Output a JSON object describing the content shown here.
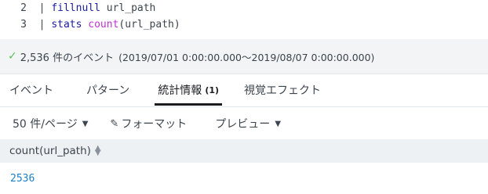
{
  "editor": {
    "lines": [
      {
        "number": "2",
        "pipe": "|",
        "command": "fillnull",
        "rest": " url_path"
      },
      {
        "number": "3",
        "pipe": "|",
        "command": "stats",
        "function": "count",
        "args": "(url_path)"
      }
    ]
  },
  "status": {
    "check_icon": "check-icon",
    "event_count": "2,536 件のイベント",
    "time_range": "(2019/07/01 0:00:00.000〜2019/08/07 0:00:00.000)"
  },
  "tabs": [
    {
      "label": "イベント"
    },
    {
      "label": "パターン"
    },
    {
      "label": "統計情報",
      "count": "(1)",
      "active": true
    },
    {
      "label": "視覚エフェクト"
    }
  ],
  "toolbar": {
    "page_size": "50 件/ページ",
    "format": "フォーマット",
    "preview": "プレビュー"
  },
  "table": {
    "columns": [
      "count(url_path)"
    ],
    "rows": [
      [
        "2536"
      ]
    ]
  },
  "colors": {
    "keyword": "#1a1c9b",
    "function": "#c22fd6",
    "success": "#5cc05c",
    "value_link": "#1b7fc5"
  }
}
